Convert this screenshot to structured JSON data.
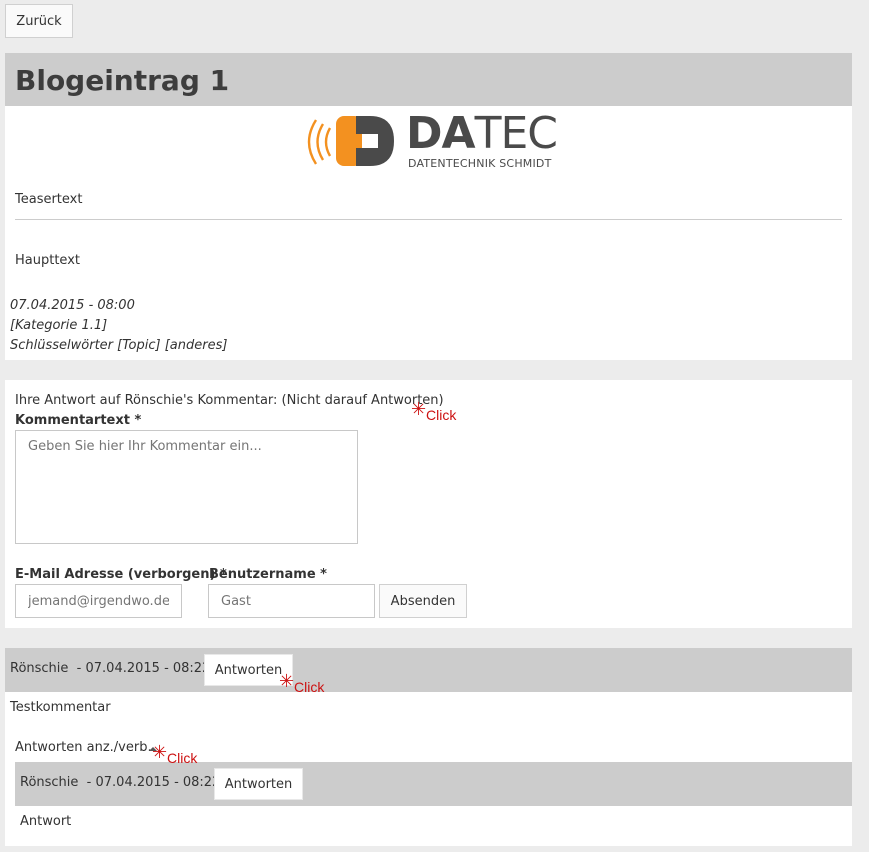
{
  "toolbar": {
    "back_label": "Zurück"
  },
  "post": {
    "title": "Blogeintrag 1",
    "logo": {
      "brand": "DATEC",
      "brand_da": "DA",
      "brand_tec": "TEC",
      "tagline": "DATENTECHNIK SCHMIDT",
      "accent_color": "#f39120",
      "dark_color": "#4a4a4a"
    },
    "teaser": "Teasertext",
    "main_text": "Haupttext",
    "date": "07.04.2015 - 08:00",
    "category": "[Kategorie 1.1]",
    "keywords": "Schlüsselwörter [Topic] [anderes]"
  },
  "reply_form": {
    "reply_info": "Ihre Antwort auf Rönschie's Kommentar: (Nicht darauf Antworten)",
    "comment_label": "Kommentartext *",
    "comment_placeholder": "Geben Sie hier Ihr Kommentar ein...",
    "email_label": "E-Mail Adresse (verborgen) *",
    "username_label": "Benutzername *",
    "email_placeholder": "jemand@irgendwo.de",
    "username_placeholder": "Gast",
    "submit_label": "Absenden"
  },
  "comments": [
    {
      "author_line": "Rönschie  - 07.04.2015 - 08:22",
      "reply_label": "Antworten",
      "text": "Testkommentar",
      "toggle_label": "Antworten anz./verb.",
      "replies": [
        {
          "author_line": "Rönschie  - 07.04.2015 - 08:22",
          "reply_label": "Antworten",
          "text": "Antwort"
        }
      ]
    }
  ],
  "annotations": {
    "click_label": "Click",
    "star": "✳"
  }
}
